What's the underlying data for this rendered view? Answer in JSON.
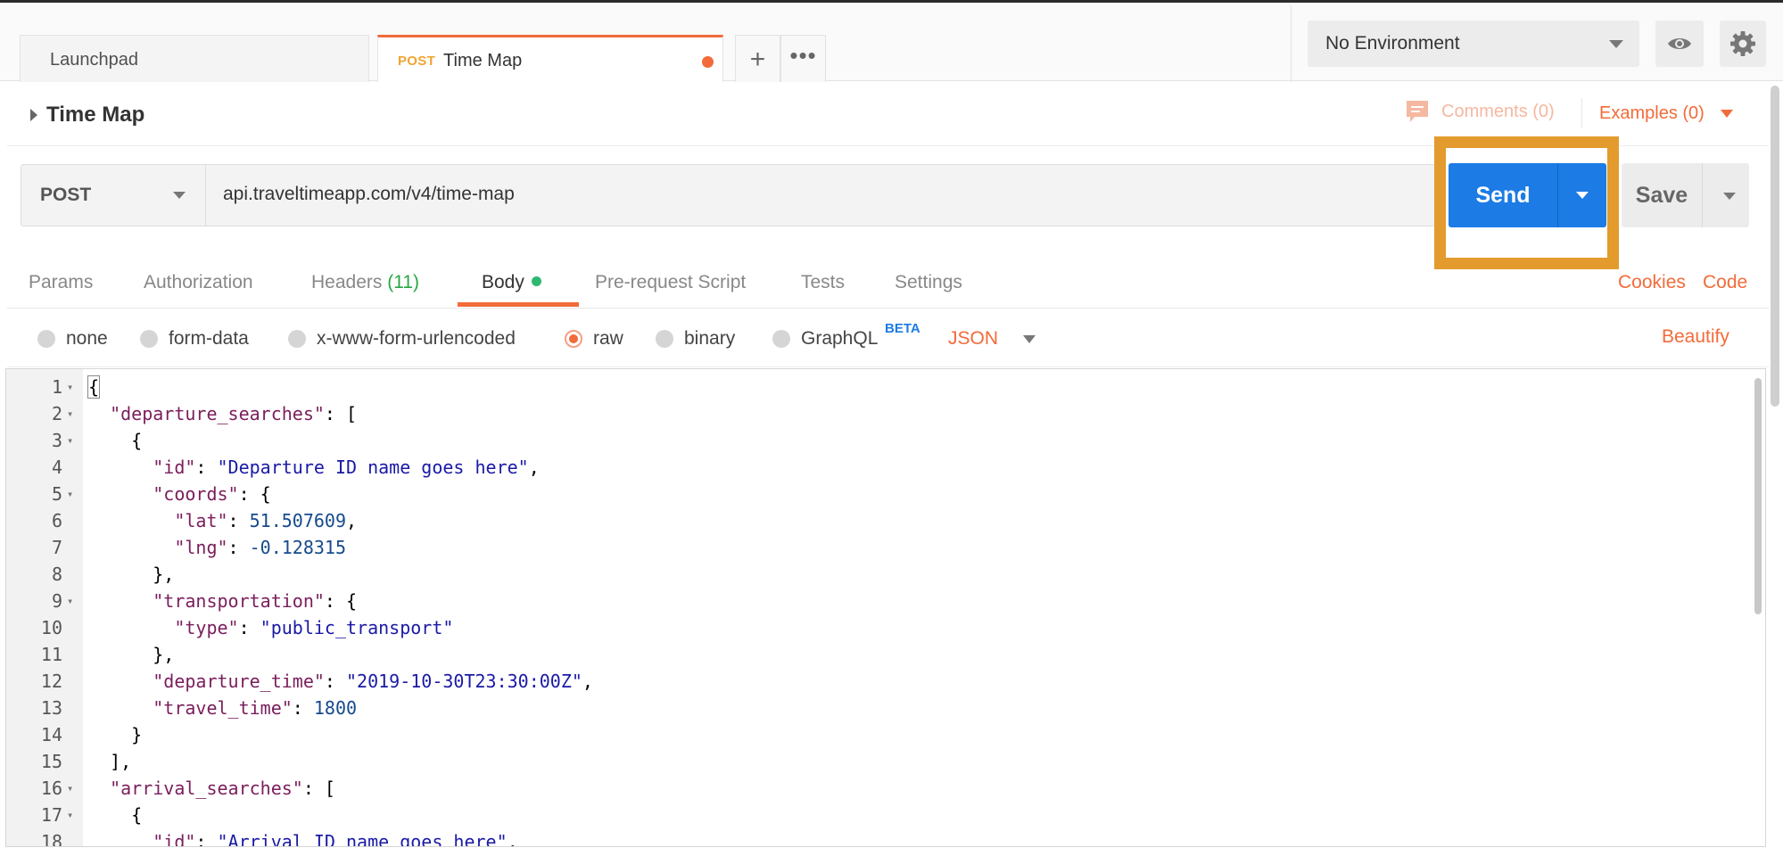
{
  "tabs": {
    "launchpad_label": "Launchpad",
    "active_method": "POST",
    "active_title": "Time Map",
    "more_glyph": "•••",
    "plus_glyph": "+"
  },
  "environment": {
    "selected": "No Environment",
    "eye_icon": "eye-icon",
    "settings_icon": "gear-icon"
  },
  "request": {
    "title": "Time Map",
    "comments_label": "Comments (0)",
    "examples_label": "Examples (0)",
    "method": "POST",
    "url": "api.traveltimeapp.com/v4/time-map",
    "send_label": "Send",
    "save_label": "Save"
  },
  "request_tabs": {
    "params": "Params",
    "authorization": "Authorization",
    "headers": "Headers",
    "headers_count": "(11)",
    "body": "Body",
    "prerequest": "Pre-request Script",
    "tests": "Tests",
    "settings": "Settings",
    "cookies": "Cookies",
    "code": "Code"
  },
  "body_types": {
    "none": "none",
    "form_data": "form-data",
    "urlencoded": "x-www-form-urlencoded",
    "raw": "raw",
    "binary": "binary",
    "graphql": "GraphQL",
    "beta": "BETA",
    "format": "JSON",
    "beautify": "Beautify",
    "selected": "raw"
  },
  "editor": {
    "lines": [
      {
        "n": "1",
        "fold": true,
        "text": "{"
      },
      {
        "n": "2",
        "fold": true,
        "text": "  \"departure_searches\": ["
      },
      {
        "n": "3",
        "fold": true,
        "text": "    {"
      },
      {
        "n": "4",
        "fold": false,
        "text": "      \"id\": \"Departure ID name goes here\","
      },
      {
        "n": "5",
        "fold": true,
        "text": "      \"coords\": {"
      },
      {
        "n": "6",
        "fold": false,
        "text": "        \"lat\": 51.507609,"
      },
      {
        "n": "7",
        "fold": false,
        "text": "        \"lng\": -0.128315"
      },
      {
        "n": "8",
        "fold": false,
        "text": "      },"
      },
      {
        "n": "9",
        "fold": true,
        "text": "      \"transportation\": {"
      },
      {
        "n": "10",
        "fold": false,
        "text": "        \"type\": \"public_transport\""
      },
      {
        "n": "11",
        "fold": false,
        "text": "      },"
      },
      {
        "n": "12",
        "fold": false,
        "text": "      \"departure_time\": \"2019-10-30T23:30:00Z\","
      },
      {
        "n": "13",
        "fold": false,
        "text": "      \"travel_time\": 1800"
      },
      {
        "n": "14",
        "fold": false,
        "text": "    }"
      },
      {
        "n": "15",
        "fold": false,
        "text": "  ],"
      },
      {
        "n": "16",
        "fold": true,
        "text": "  \"arrival_searches\": ["
      },
      {
        "n": "17",
        "fold": true,
        "text": "    {"
      },
      {
        "n": "18",
        "fold": false,
        "text": "      \"id\": \"Arrival ID name goes here\","
      }
    ]
  },
  "colors": {
    "accent": "#f26b3a",
    "send_button": "#1c7be5",
    "highlight_box": "#e39b2d",
    "body_dot": "#2eb872"
  }
}
